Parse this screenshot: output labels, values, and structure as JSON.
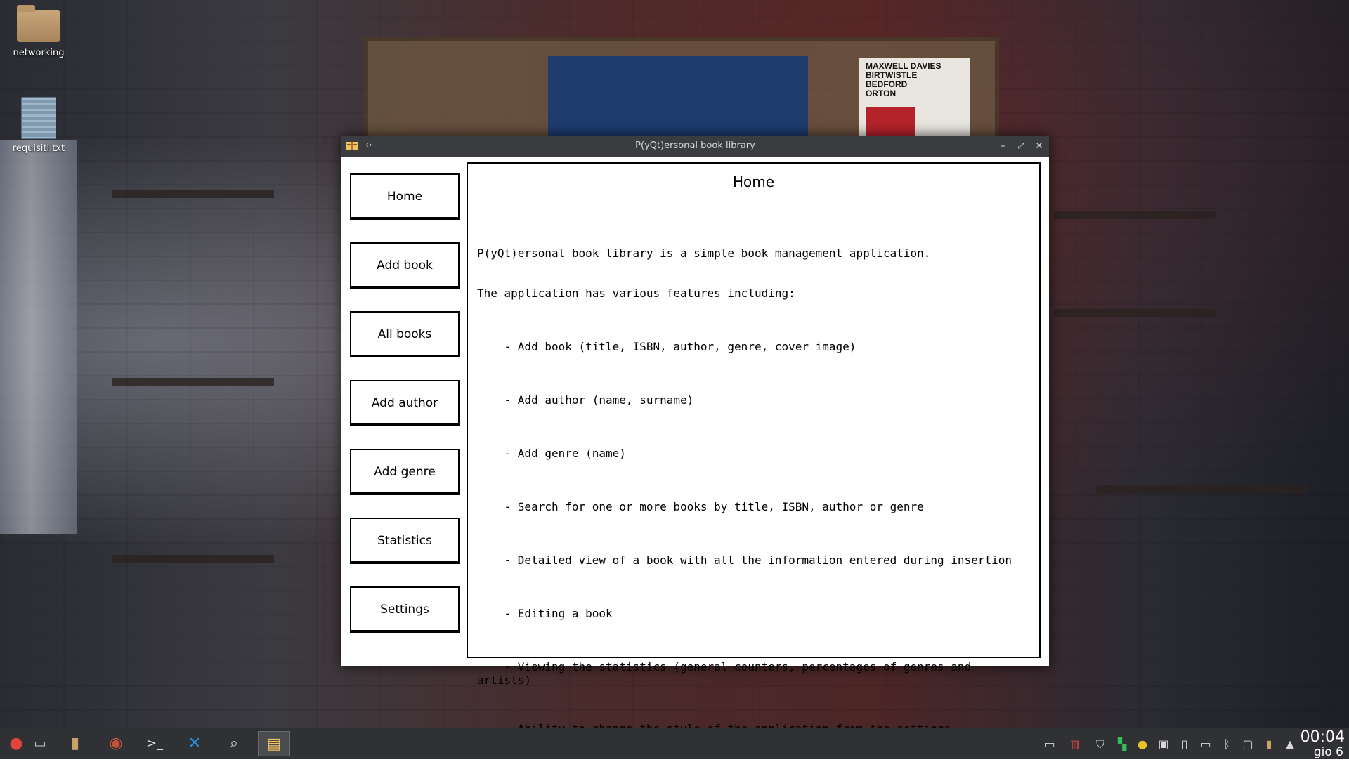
{
  "desktop": {
    "icons": [
      {
        "label": "networking",
        "icon": "folder-icon"
      },
      {
        "label": "requisiti.txt",
        "icon": "text-file-icon"
      }
    ]
  },
  "window": {
    "title": "P(yQt)ersonal book library",
    "controls": [
      "minimize",
      "maximize",
      "close"
    ]
  },
  "sidebar": {
    "buttons": [
      "Home",
      "Add book",
      "All books",
      "Add author",
      "Add genre",
      "Statistics",
      "Settings"
    ]
  },
  "content": {
    "title": "Home",
    "intro_line1": "P(yQt)ersonal book library is a simple book management application.",
    "intro_line2": "The application has various features including:",
    "features": [
      "    - Add book (title, ISBN, author, genre, cover image)",
      "    - Add author (name, surname)",
      "    - Add genre (name)",
      "    - Search for one or more books by title, ISBN, author or genre",
      "    - Detailed view of a book with all the information entered during insertion",
      "    - Editing a book",
      "    - Viewing the statistics (general counters, percentages of genres and artists)",
      "    - Ability to change the style of the application from the settings"
    ]
  },
  "taskbar": {
    "apps": [
      "app-menu-icon",
      "show-desktop-icon",
      "file-manager-icon",
      "web-browser-icon",
      "terminal-icon",
      "vscode-icon",
      "search-icon",
      "book-library-icon"
    ],
    "tray": [
      "window-icon",
      "trash-icon",
      "shield-icon",
      "manjaro-icon",
      "notification-icon",
      "console-icon",
      "clipboard-icon",
      "battery-icon",
      "bluetooth-icon",
      "display-icon",
      "device-icon",
      "expand-icon"
    ],
    "clock_time": "00:04",
    "clock_date": "gio 6"
  },
  "colors": {
    "titlebar": "#3a3c40",
    "taskbar": "#2f3134",
    "border": "#000000"
  }
}
